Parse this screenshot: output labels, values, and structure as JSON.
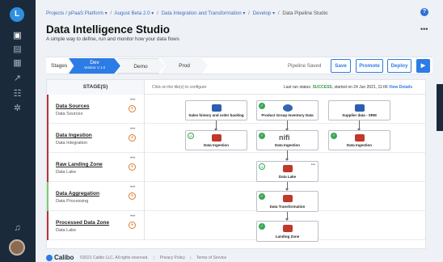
{
  "rail": {
    "logo_letter": "L"
  },
  "breadcrumb": {
    "items": [
      "Projects / pPaaS Platform",
      "August Beta 2.0",
      "Data Integration and Transformation",
      "Develop",
      "Data Pipeline Studio"
    ],
    "separator": "/"
  },
  "header": {
    "title": "Data Intelligence Studio",
    "subtitle": "A simple way to define, run and monitor how your data flows",
    "help_icon": "?",
    "more_icon": "•••"
  },
  "stages": {
    "label": "Stages",
    "dev_name": "Dev",
    "dev_version": "Version: V 1.0",
    "demo": "Demo",
    "prod": "Prod",
    "status": "Pipeline Saved",
    "buttons": {
      "save": "Save",
      "promote": "Promote",
      "deploy": "Deploy",
      "run": "▶"
    }
  },
  "grid": {
    "stage_header": "STAGE(S)",
    "hint": "Click on the tile(s) to configure",
    "run_status_prefix": "Last run status:",
    "run_status_value": "SUCCESS",
    "run_status_suffix": ", started on 24 Jun 2021, 11:06",
    "view_details": "View Details"
  },
  "rows": [
    {
      "name": "Data Sources",
      "type": "Data Sources",
      "color": "#b8323f"
    },
    {
      "name": "Data Ingestion",
      "type": "Data Integration",
      "color": "#b8323f"
    },
    {
      "name": "Raw Landing Zone",
      "type": "Data Lake",
      "color": "#b8323f"
    },
    {
      "name": "Data Aggregation",
      "type": "Data Processing",
      "color": "#7ecb6a"
    },
    {
      "name": "Processed Data Zone",
      "type": "Data Lake",
      "color": "#b8323f"
    }
  ],
  "nodes": {
    "src1": "Sales history and order backlog",
    "src2": "Product Group Inventory Data",
    "src3": "Supplier data - SRM",
    "ing1": "Data Ingestion",
    "ing2": "Data Ingestion",
    "ing2_logo_text": "nifi",
    "ing3": "Data Ingestion",
    "lake1": "Data Lake",
    "transform": "Data Transformation",
    "landing": "Landing Zone"
  },
  "footer": {
    "brand": "Calibo",
    "copyright": "©2021 Calibo LLC. All rights reserved.",
    "privacy": "Privacy Policy",
    "terms": "Terms of Service"
  }
}
